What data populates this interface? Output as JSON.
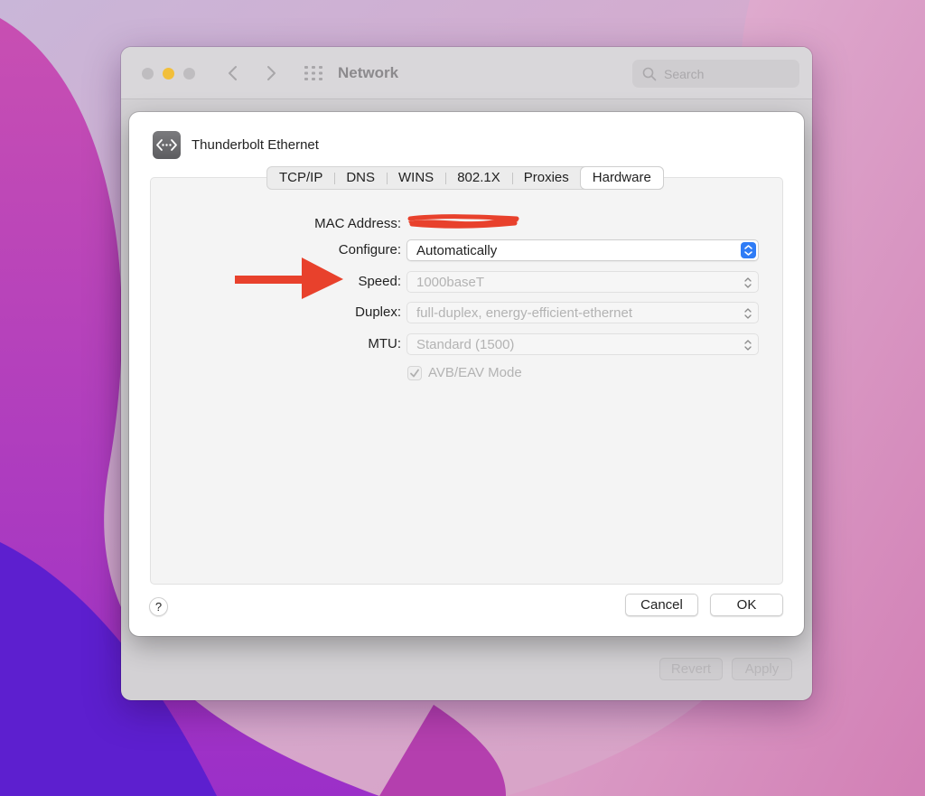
{
  "window": {
    "title": "Network",
    "search_placeholder": "Search",
    "revert_label": "Revert",
    "apply_label": "Apply"
  },
  "sheet": {
    "interface_name": "Thunderbolt Ethernet",
    "tabs": [
      {
        "label": "TCP/IP",
        "active": false
      },
      {
        "label": "DNS",
        "active": false
      },
      {
        "label": "WINS",
        "active": false
      },
      {
        "label": "802.1X",
        "active": false
      },
      {
        "label": "Proxies",
        "active": false
      },
      {
        "label": "Hardware",
        "active": true
      }
    ],
    "mac_label": "MAC Address:",
    "configure_label": "Configure:",
    "configure_value": "Automatically",
    "speed_label": "Speed:",
    "speed_value": "1000baseT",
    "duplex_label": "Duplex:",
    "duplex_value": "full-duplex, energy-efficient-ethernet",
    "mtu_label": "MTU:",
    "mtu_value": "Standard (1500)",
    "avb_label": "AVB/EAV Mode",
    "avb_checked": true,
    "help_label": "?",
    "cancel_label": "Cancel",
    "ok_label": "OK"
  },
  "colors": {
    "annotation_arrow": "#e8412c",
    "redaction": "#e8412c",
    "accent": "#2f7cf6"
  },
  "icons": [
    "chevron-left-icon",
    "chevron-right-icon",
    "grid-icon",
    "search-icon",
    "ethernet-icon",
    "checkmark-icon",
    "arrow-annotation"
  ]
}
